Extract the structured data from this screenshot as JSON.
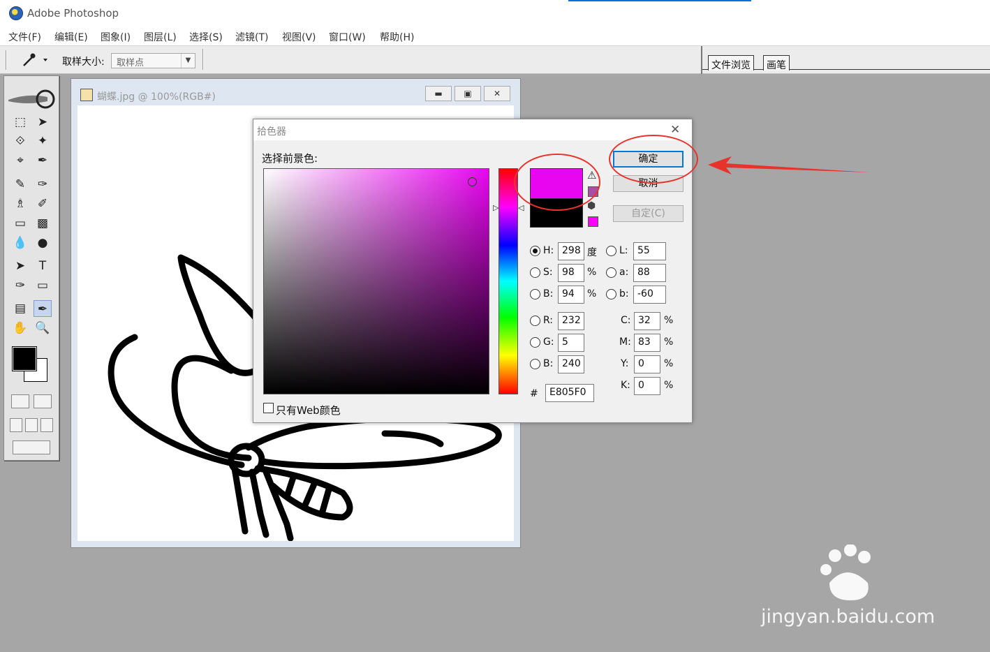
{
  "app": {
    "title": "Adobe Photoshop",
    "icon": "photoshop-eye-icon"
  },
  "menu": [
    "文件(F)",
    "编辑(E)",
    "图象(I)",
    "图层(L)",
    "选择(S)",
    "滤镜(T)",
    "视图(V)",
    "窗口(W)",
    "帮助(H)"
  ],
  "options_bar": {
    "tool_icon": "eyedropper-icon",
    "sample_size_label": "取样大小:",
    "sample_size_value": "取样点",
    "palette_tabs": [
      "文件浏览",
      "画笔"
    ]
  },
  "toolbox": {
    "tools": [
      "marquee-icon",
      "move-icon",
      "lasso-icon",
      "magic-wand-icon",
      "crop-icon",
      "slice-icon",
      "healing-icon",
      "brush-icon",
      "stamp-icon",
      "history-brush-icon",
      "eraser-icon",
      "gradient-icon",
      "blur-icon",
      "dodge-icon",
      "path-select-icon",
      "type-icon",
      "pen-icon",
      "shape-icon",
      "notes-icon",
      "eyedropper-icon",
      "hand-icon",
      "zoom-icon"
    ],
    "selected_tool": "eyedropper-icon",
    "foreground_color": "#000000",
    "background_color": "#ffffff"
  },
  "document": {
    "title": "蝴蝶.jpg @ 100%(RGB#)",
    "buttons": [
      "minimize-icon",
      "restore-icon",
      "close-icon"
    ]
  },
  "color_picker": {
    "title": "拾色器",
    "caption": "选择前景色:",
    "new_color": "#e805f0",
    "current_color": "#000000",
    "gamut_swatch_color": "#a94fa6",
    "web_swatch_color": "#ff00ff",
    "buttons": {
      "ok": "确定",
      "cancel": "取消",
      "custom": "自定(C)"
    },
    "fields": {
      "H": {
        "label": "H:",
        "value": "298",
        "unit": "度",
        "selected": true
      },
      "S": {
        "label": "S:",
        "value": "98",
        "unit": "%"
      },
      "B": {
        "label": "B:",
        "value": "94",
        "unit": "%"
      },
      "R": {
        "label": "R:",
        "value": "232"
      },
      "G": {
        "label": "G:",
        "value": "5"
      },
      "Bl": {
        "label": "B:",
        "value": "240"
      },
      "L": {
        "label": "L:",
        "value": "55"
      },
      "a": {
        "label": "a:",
        "value": "88"
      },
      "b": {
        "label": "b:",
        "value": "-60"
      },
      "C": {
        "label": "C:",
        "value": "32",
        "unit": "%"
      },
      "M": {
        "label": "M:",
        "value": "83",
        "unit": "%"
      },
      "Y": {
        "label": "Y:",
        "value": "0",
        "unit": "%"
      },
      "K": {
        "label": "K:",
        "value": "0",
        "unit": "%"
      }
    },
    "hex_label": "#",
    "hex_value": "E805F0",
    "web_only_label": "只有Web颜色",
    "web_only_checked": false
  },
  "annotation_color": "#e8332d",
  "watermark": {
    "logo": "baidu-jingyan-logo",
    "url": "jingyan.baidu.com"
  }
}
